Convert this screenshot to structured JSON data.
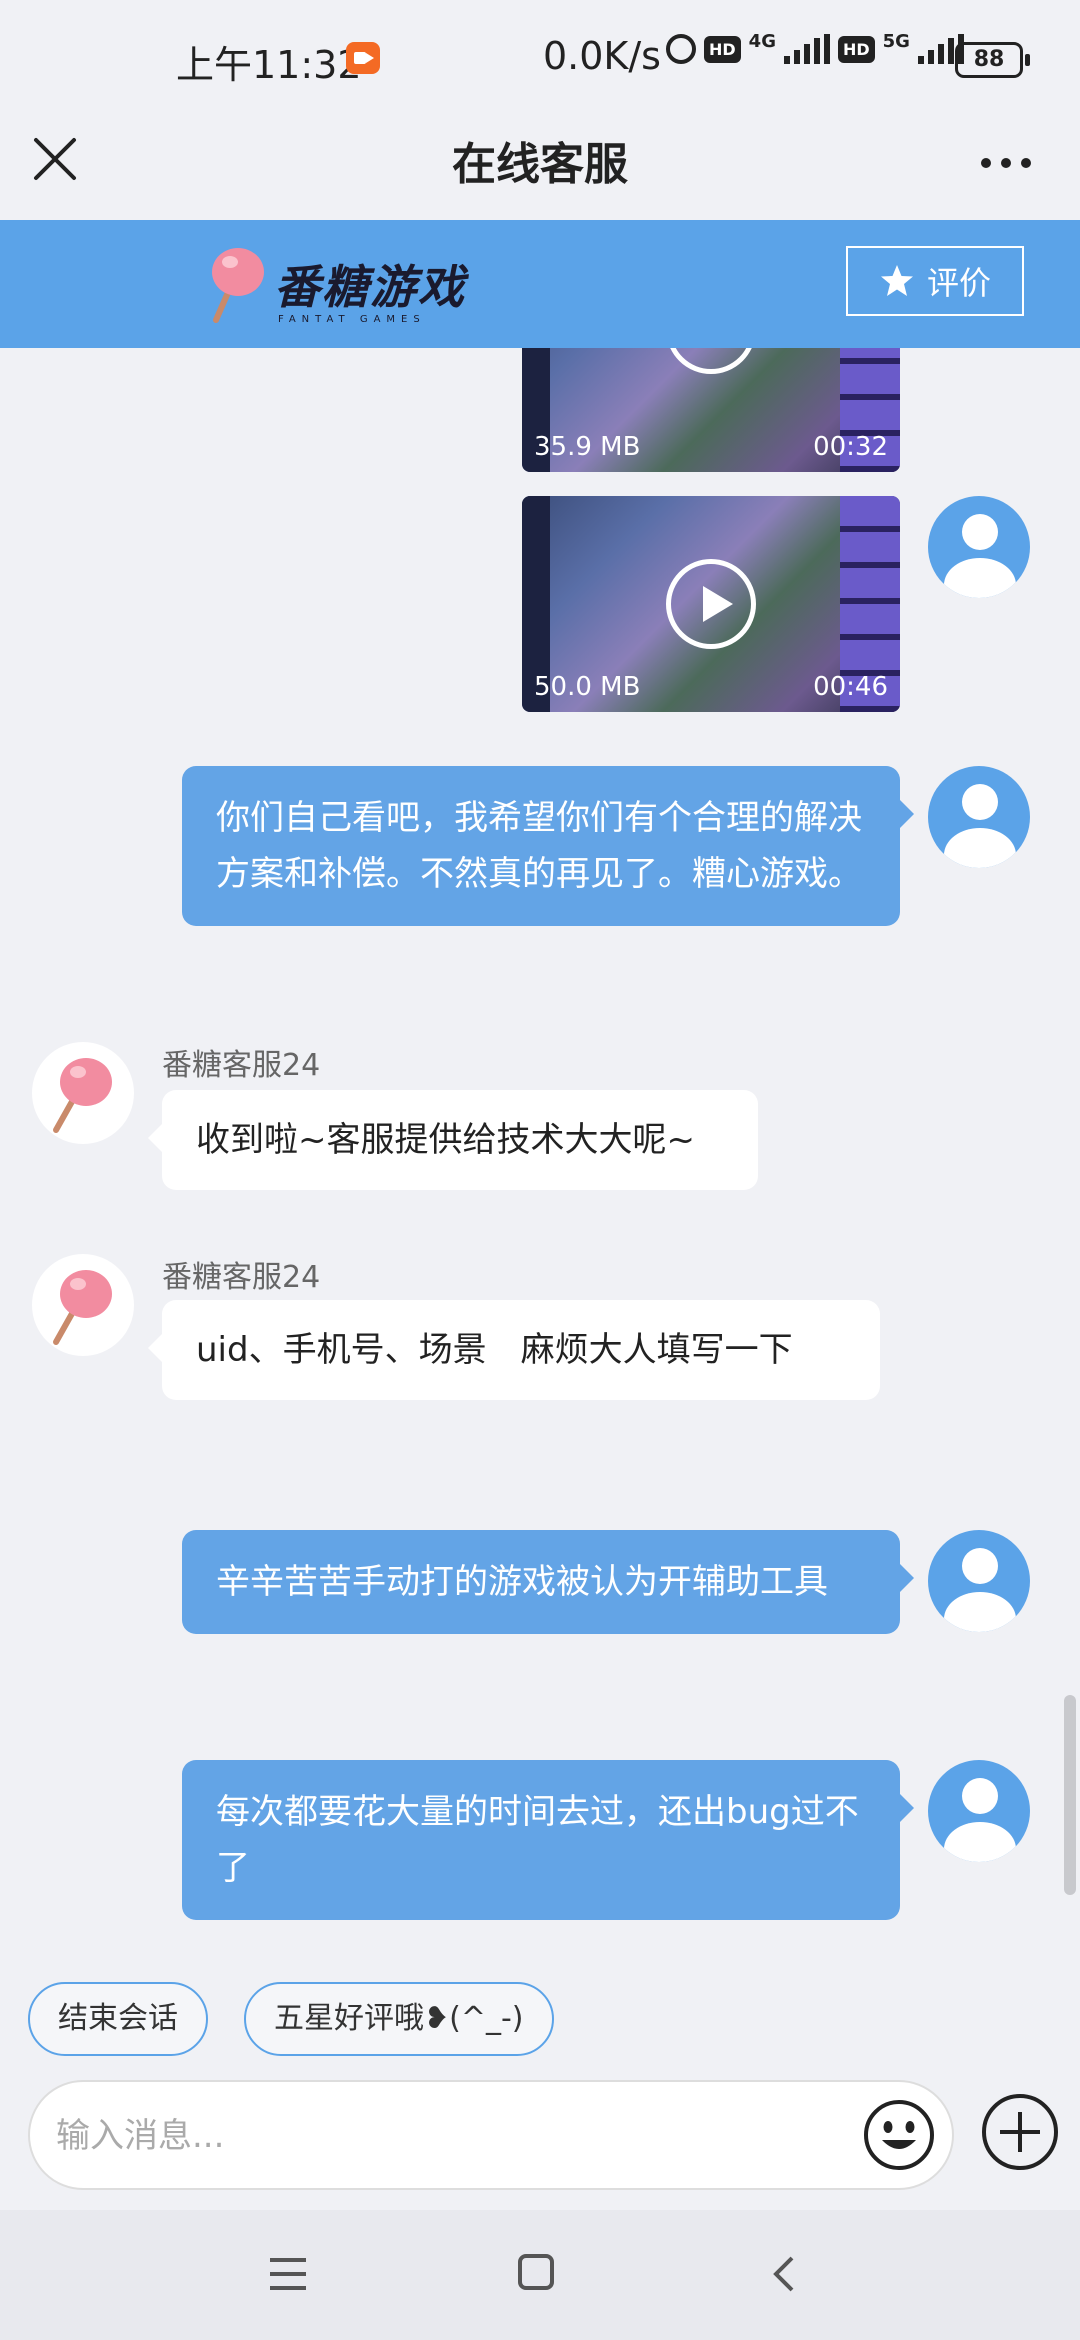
{
  "status_bar": {
    "time": "上午11:32",
    "net_speed": "0.0K/s",
    "hd1": "HD",
    "net1": "4G",
    "hd2": "HD",
    "net2": "5G",
    "battery": "88"
  },
  "header": {
    "title": "在线客服"
  },
  "banner": {
    "brand": "番糖游戏",
    "brand_sub": "FANTAT GAMES",
    "rate_label": "评价"
  },
  "messages": {
    "video1": {
      "size": "35.9 MB",
      "duration": "00:32"
    },
    "video2": {
      "size": "50.0 MB",
      "duration": "00:46"
    },
    "user1": "你们自己看吧，我希望你们有个合理的解决方案和补偿。不然真的再见了。糟心游戏。",
    "cs1_name": "番糖客服24",
    "cs1_text": "收到啦~客服提供给技术大大呢~",
    "cs2_name": "番糖客服24",
    "cs2_text": "uid、手机号、场景　麻烦大人填写一下",
    "user2": "辛辛苦苦手动打的游戏被认为开辅助工具",
    "user3": "每次都要花大量的时间去过，还出bug过不了"
  },
  "quick_replies": {
    "end_session": "结束会话",
    "five_star": "五星好评哦❥(^_-)"
  },
  "input": {
    "placeholder": "输入消息..."
  },
  "colors": {
    "accent": "#5ba3e8",
    "user_bubble": "#63a4e6",
    "background": "#f0f1f5"
  }
}
